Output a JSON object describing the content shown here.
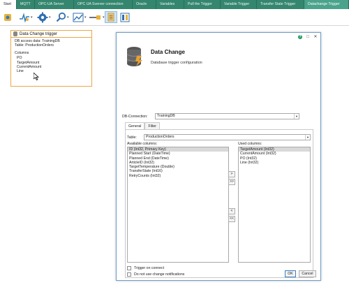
{
  "tabs": [
    {
      "label": "Start",
      "state": "active"
    },
    {
      "label": "MQTT"
    },
    {
      "label": "OPC-UA Server"
    },
    {
      "label": "OPC UA Sverver connection"
    },
    {
      "label": "Oracle"
    },
    {
      "label": "Variables"
    },
    {
      "label": "Pull the Trigger"
    },
    {
      "label": "Variable Trigger"
    },
    {
      "label": "Transfer State Trigger"
    },
    {
      "label": "Datachange Trigger",
      "state": "selected"
    }
  ],
  "toolbar": {
    "icons": [
      "connection-icon",
      "pulse-icon",
      "gear-icon",
      "search-icon",
      "chart-icon",
      "pipe-icon",
      "list-icon",
      "layout-icon"
    ]
  },
  "trigger_card": {
    "title": "Data Change trigger",
    "access": "DB access data: TrainingDB",
    "table": "Table: ProductionOrders",
    "columns_label": "Columns",
    "columns": [
      "PO",
      "TargetAmount",
      "CurrentAmount",
      "Line"
    ]
  },
  "dialog": {
    "help": "?",
    "maximize": "□",
    "close": "✕",
    "title": "Data Change",
    "subtitle": "Database trigger configuration",
    "db_connection_label": "DB-Connection:",
    "db_connection_value": "TrainingDB",
    "tabs": [
      "General",
      "Filter"
    ],
    "active_tab": "General",
    "table_label": "Table:",
    "table_value": "ProductionOrders",
    "available_label": "Available columns:",
    "available_columns": [
      "ID (Int32, Primary Key)",
      "Planned Start (DateTime)",
      "Planned End (DateTime)",
      "ArticleID (Int32)",
      "TargetTemperature (Double)",
      "TransferState (Int16)",
      "RetryCounts (Int32)"
    ],
    "used_label": "Used columns:",
    "used_columns": [
      "TargetAmount (Int32)",
      "CurrentAmount (Int32)",
      "PO (Int32)",
      "Line (Int32)"
    ],
    "move_buttons": [
      ">",
      ">>",
      "<",
      "<<"
    ],
    "trigger_on_connect": "Trigger on connect",
    "no_change_notifications": "Do not use change notifications",
    "ok": "OK",
    "cancel": "Cancel"
  },
  "colors": {
    "tabbar": "#34866f",
    "card_border": "#e8a845",
    "dialog_border": "#6e9fc9"
  }
}
